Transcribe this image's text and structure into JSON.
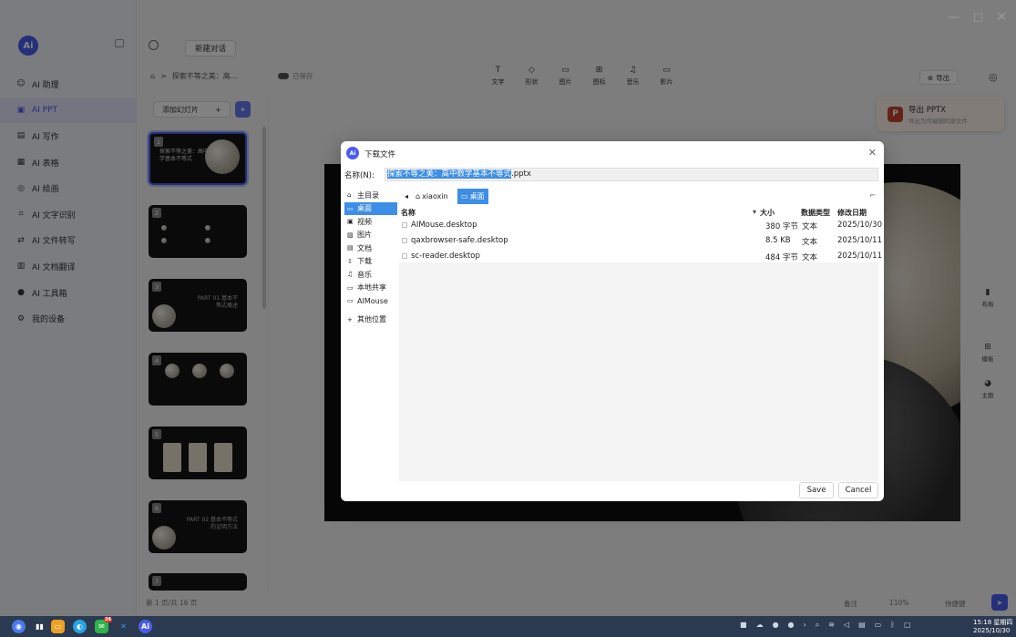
{
  "window_controls": {
    "minimize": "—",
    "maximize": "◻",
    "close": "✕"
  },
  "sidebar": {
    "logo": "Ai",
    "items": [
      {
        "label": "AI 助理",
        "icon": "☺"
      },
      {
        "label": "AI PPT",
        "icon": "▣"
      },
      {
        "label": "AI 写作",
        "icon": "▤"
      },
      {
        "label": "AI 表格",
        "icon": "▦"
      },
      {
        "label": "AI 绘画",
        "icon": "◎"
      },
      {
        "label": "AI 文字识别",
        "icon": "⌗"
      },
      {
        "label": "AI 文件转写",
        "icon": "⇄"
      },
      {
        "label": "AI 文档翻译",
        "icon": "▥"
      },
      {
        "label": "AI 工具箱",
        "icon": "●"
      },
      {
        "label": "我的设备",
        "icon": "⚙"
      }
    ]
  },
  "topbar": {
    "new_chat": "新建对话"
  },
  "doc": {
    "home_icon": "⌂",
    "breadcrumb_sep": ">",
    "breadcrumb": "探索不等之美：高...",
    "saved": "已保存"
  },
  "tools": [
    {
      "label": "文字",
      "icon": "T"
    },
    {
      "label": "形状",
      "icon": "◇"
    },
    {
      "label": "图片",
      "icon": "▭"
    },
    {
      "label": "图标",
      "icon": "⊞"
    },
    {
      "label": "音乐",
      "icon": "♫"
    },
    {
      "label": "影片",
      "icon": "▭"
    }
  ],
  "export": {
    "label": "导出",
    "pop_title": "导出 PPTX",
    "pop_sub": "导出为可编辑的源文件",
    "ppt_letter": "P"
  },
  "slides": {
    "add_label": "添加幻灯片",
    "plus": "+",
    "thumbs": [
      {
        "num": "1",
        "title": "探索不等之美：高中数学基本不等式"
      },
      {
        "num": "2",
        "title": ""
      },
      {
        "num": "3",
        "title": "PART 01 基本不等式概述"
      },
      {
        "num": "4",
        "title": ""
      },
      {
        "num": "5",
        "title": ""
      },
      {
        "num": "6",
        "title": "PART 02 基本不等式的证明方法"
      },
      {
        "num": "7",
        "title": ""
      }
    ]
  },
  "rightbar": [
    {
      "label": "布局",
      "icon": "▮"
    },
    {
      "label": "模板",
      "icon": "⊞"
    },
    {
      "label": "主题",
      "icon": "◕"
    }
  ],
  "bottombar": {
    "page_info": "第 1 页/共 16 页",
    "remark": "备注",
    "zoom": "110%",
    "shortcut": "快捷键"
  },
  "dialog": {
    "title": "下载文件",
    "name_label": "名称(N):",
    "filename_selected": "探索不等之美：高中数学基本不等式",
    "filename_ext": ".pptx",
    "places": [
      {
        "label": "主目录",
        "icon": "⌂"
      },
      {
        "label": "桌面",
        "icon": "▭"
      },
      {
        "label": "视频",
        "icon": "▣"
      },
      {
        "label": "图片",
        "icon": "▨"
      },
      {
        "label": "文档",
        "icon": "▤"
      },
      {
        "label": "下载",
        "icon": "⇩"
      },
      {
        "label": "音乐",
        "icon": "♫"
      },
      {
        "label": "本地共享",
        "icon": "▭"
      },
      {
        "label": "AIMouse",
        "icon": "▭"
      },
      {
        "label": "其他位置",
        "icon": "+"
      }
    ],
    "path": [
      "xiaoxin",
      "桌面"
    ],
    "columns": {
      "name": "名称",
      "size": "大小",
      "type": "数据类型",
      "date": "修改日期"
    },
    "files": [
      {
        "name": "AIMouse.desktop",
        "size": "380 字节",
        "type": "文本",
        "date": "2025/10/30"
      },
      {
        "name": "qaxbrowser-safe.desktop",
        "size": "8.5 KB",
        "type": "文本",
        "date": "2025/10/11"
      },
      {
        "name": "sc-reader.desktop",
        "size": "484 字节",
        "type": "文本",
        "date": "2025/10/11"
      }
    ],
    "save": "Save",
    "cancel": "Cancel"
  },
  "taskbar": {
    "clock_time": "15:18 星期四",
    "clock_date": "2025/10/30",
    "notify_badge": "34"
  }
}
